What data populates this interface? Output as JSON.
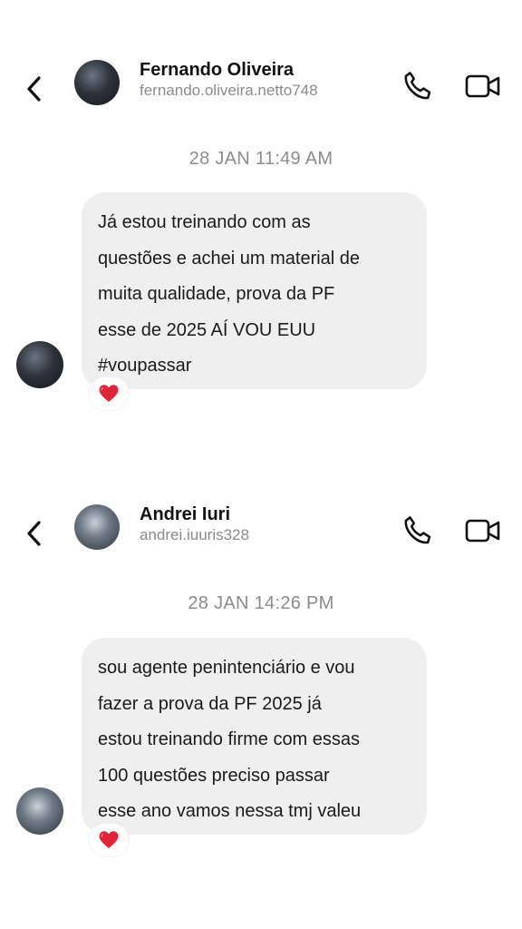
{
  "conversations": [
    {
      "name": "Fernando Oliveira",
      "handle": "fernando.oliveira.netto748",
      "timestamp": "28 JAN 11:49 AM",
      "message_lines": [
        "Já estou treinando com as",
        "questões e achei um material de",
        "muita qualidade, prova da PF",
        "esse de 2025 AÍ VOU EUU",
        "#voupassar"
      ],
      "reaction": "heart-emoji"
    },
    {
      "name": "Andrei Iuri",
      "handle": "andrei.iuuris328",
      "timestamp": "28 JAN 14:26 PM",
      "message_lines": [
        "sou agente penintenciário e vou",
        "fazer a prova da PF 2025 já",
        "estou treinando firme com essas",
        "100 questões preciso passar",
        "esse ano vamos nessa tmj valeu"
      ],
      "reaction": "heart-emoji"
    }
  ],
  "icons": {
    "back": "chevron-left-icon",
    "call": "phone-icon",
    "video": "video-camera-icon",
    "reaction": "heart-icon"
  },
  "colors": {
    "bubble": "#efeff0",
    "heart": "#e0243a",
    "muted_text": "#8c8c8c"
  }
}
